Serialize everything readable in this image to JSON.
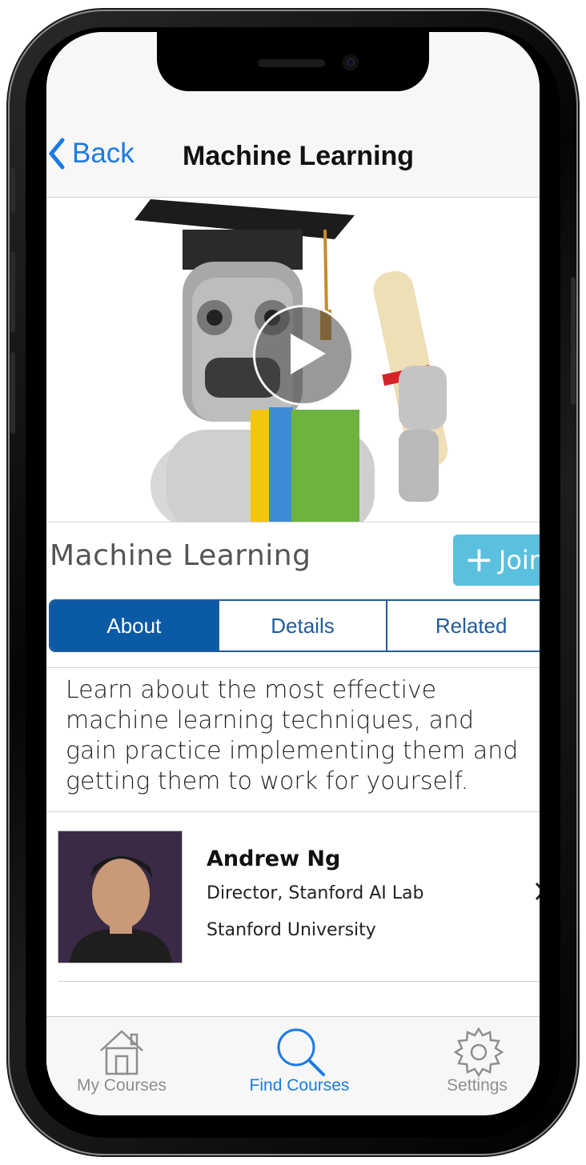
{
  "nav": {
    "back_label": "Back",
    "title": "Machine Learning"
  },
  "hero": {
    "image": "robot-graduate-illustration",
    "play_icon": "play-icon"
  },
  "course": {
    "title": "Machine Learning",
    "join_label": "Join"
  },
  "tabs": [
    {
      "label": "About",
      "active": true
    },
    {
      "label": "Details",
      "active": false
    },
    {
      "label": "Related",
      "active": false
    }
  ],
  "about": {
    "description": "Learn about the most effective machine learning techniques, and gain practice implementing them and getting them to work for yourself."
  },
  "instructor": {
    "name": "Andrew Ng",
    "role": "Director, Stanford AI Lab",
    "organization": "Stanford University"
  },
  "tabbar": {
    "items": [
      {
        "label": "My Courses",
        "icon": "home-icon",
        "active": false
      },
      {
        "label": "Find Courses",
        "icon": "search-icon",
        "active": true
      },
      {
        "label": "Settings",
        "icon": "gear-icon",
        "active": false
      }
    ]
  },
  "colors": {
    "accent": "#1a7be6",
    "tab_active": "#0b5aa6",
    "join": "#5bc0de"
  }
}
